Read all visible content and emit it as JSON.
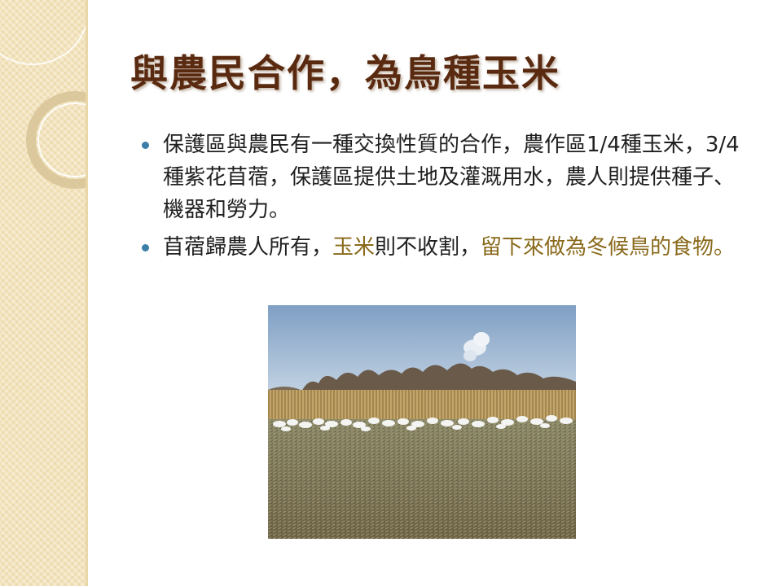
{
  "title": "與農民合作，為鳥種玉米",
  "bullets": [
    {
      "segments": [
        {
          "text": "保護區與農民有一種交換性質的合作，農作區1/4種玉米，3/4種紫花苜蓿，保護區提供土地及灌溉用水，農人則提供種子、機器和勞力。",
          "highlight": false
        }
      ]
    },
    {
      "segments": [
        {
          "text": "苜蓿歸農人所有，",
          "highlight": false
        },
        {
          "text": "玉米",
          "highlight": true
        },
        {
          "text": "則不收割，",
          "highlight": false
        },
        {
          "text": "留下來做為冬候鳥的食物。",
          "highlight": true
        }
      ]
    }
  ],
  "colors": {
    "title": "#5a2a10",
    "bullet_marker": "#3b7fa8",
    "highlight": "#8a6a1c",
    "side_strip": "#f3e4bd"
  }
}
